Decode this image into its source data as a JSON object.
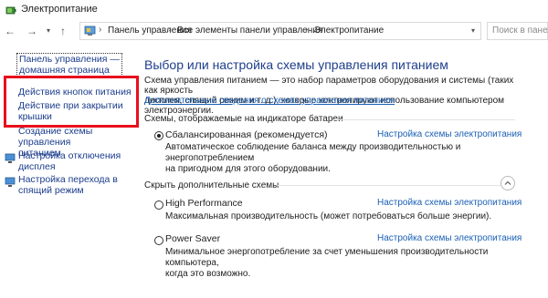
{
  "window": {
    "title": "Электропитание"
  },
  "address": {
    "breadcrumbs": [
      "Панель управления",
      "Все элементы панели управления",
      "Электропитание"
    ],
    "search_placeholder": "Поиск в панели"
  },
  "icons": {
    "app": "power-battery-icon",
    "back": "back-arrow-icon",
    "forward": "forward-arrow-icon",
    "recent": "chevron-down-icon",
    "up": "up-arrow-icon",
    "control_panel": "control-panel-icon"
  },
  "sidebar": {
    "home_line1": "Панель управления —",
    "home_line2": "домашняя страница",
    "items": [
      {
        "label": "Действия кнопок питания"
      },
      {
        "label_line1": "Действие при закрытии",
        "label_line2": "крышки"
      },
      {
        "label_line1": "Создание схемы управления",
        "label_line2": "питанием"
      },
      {
        "label_line1": "Настройка отключения",
        "label_line2": "дисплея"
      },
      {
        "label_line1": "Настройка перехода в",
        "label_line2": "спящий режим"
      }
    ]
  },
  "main": {
    "heading": "Выбор или настройка схемы управления питанием",
    "intro_line1": "Схема управления питанием — это набор параметров оборудования и системы (таких как яркость",
    "intro_line2": "дисплея, спящий режим и т. д.), которые контролируют использование компьютером электроэнергии.",
    "more_info": "Дополнительные сведения о схемах управления питанием",
    "group_battery_label": "Схемы, отображаемые на индикаторе батареи",
    "group_hidden_label": "Скрыть дополнительные схемы",
    "plans": [
      {
        "name": "Сбалансированная (рекомендуется)",
        "link": "Настройка схемы электропитания",
        "desc_line1": "Автоматическое соблюдение баланса между производительностью и энергопотреблением",
        "desc_line2": "на пригодном для этого оборудовании.",
        "selected": true
      },
      {
        "name": "High Performance",
        "link": "Настройка схемы электропитания",
        "desc_line1": "Максимальная производительность (может потребоваться больше энергии).",
        "selected": false
      },
      {
        "name": "Power Saver",
        "link": "Настройка схемы электропитания",
        "desc_line1": "Минимальное энергопотребление за счет уменьшения производительности компьютера,",
        "desc_line2": "когда это возможно.",
        "selected": false
      }
    ]
  },
  "colors": {
    "link": "#1a5fb4",
    "heading": "#1e3e8c",
    "highlight_box": "#e8101c"
  }
}
